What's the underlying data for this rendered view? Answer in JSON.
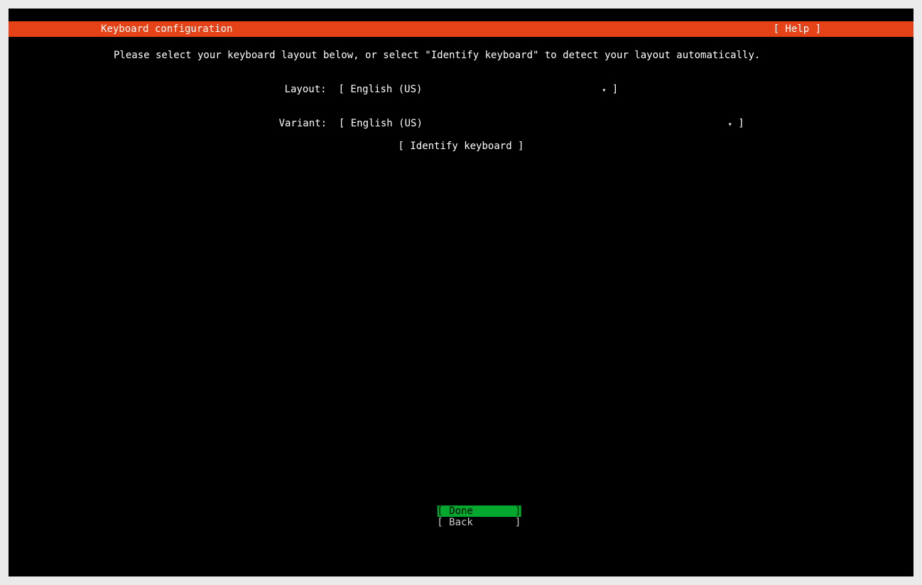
{
  "header": {
    "title": "Keyboard configuration",
    "help": "[ Help ]"
  },
  "prompt": "Please select your keyboard layout below, or select \"Identify keyboard\" to detect your layout automatically.",
  "layout": {
    "label": "Layout:",
    "select_open": "[ ",
    "value": "English (US)",
    "arrow": "▾",
    "select_close": " ]"
  },
  "variant": {
    "label": "Variant:",
    "select_open": "[ ",
    "value": "English (US)",
    "arrow": "▾",
    "select_close": " ]"
  },
  "identify": "[ Identify keyboard ]",
  "footer": {
    "done": "[ Done       ]",
    "back": "[ Back       ]"
  }
}
